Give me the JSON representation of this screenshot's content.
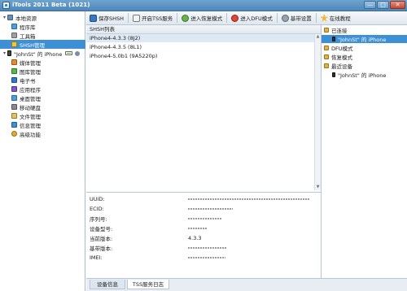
{
  "window": {
    "title": "iTools 2011 Beta (1021)",
    "buttons": {
      "minimize": "—",
      "maximize": "□",
      "close": "✕"
    }
  },
  "sidebar": {
    "local": {
      "label": "本地资源",
      "items": [
        "程序库",
        "工具箱",
        "SHSH管理"
      ],
      "selected": "SHSH管理"
    },
    "device": {
      "label": "\"JohnSt\" 的 iPhone",
      "items": [
        "媒体管理",
        "图库管理",
        "电子书",
        "应用程序",
        "桌面管理",
        "移动硬盘",
        "文件管理",
        "信息管理",
        "高级功能"
      ]
    }
  },
  "toolbar": {
    "save": "保存SHSH",
    "tss": "开启TSS服务",
    "recover": "进入恢复模式",
    "dfu": "进入DFU模式",
    "baseband": "基带设置",
    "online": "在线教程"
  },
  "shsh_list": {
    "header": "SHSH列表",
    "rows": [
      "iPhone4-4.3.3 (8J2)",
      "iPhone4-4.3.5 (8L1)",
      "iPhone4-5.0b1 (9A5220p)"
    ]
  },
  "info": {
    "uuid": "UUID:",
    "ecid": "ECID:",
    "serial": "序列号:",
    "model": "设备型号:",
    "firmware": "当前版本:",
    "firmware_value": "4.3.3",
    "baseband": "基带版本:",
    "imei": "IMEI:"
  },
  "tabs": {
    "device_info": "设备信息",
    "tss_log": "TSS服务日志"
  },
  "right_panel": {
    "connected": "已连接",
    "connected_device": "\"JohnSt\" 的 iPhone",
    "dfu": "DFU模式",
    "recovery": "恢复模式",
    "recent": "最近设备",
    "recent_device": "\"JohnSt\" 的 iPhone"
  }
}
